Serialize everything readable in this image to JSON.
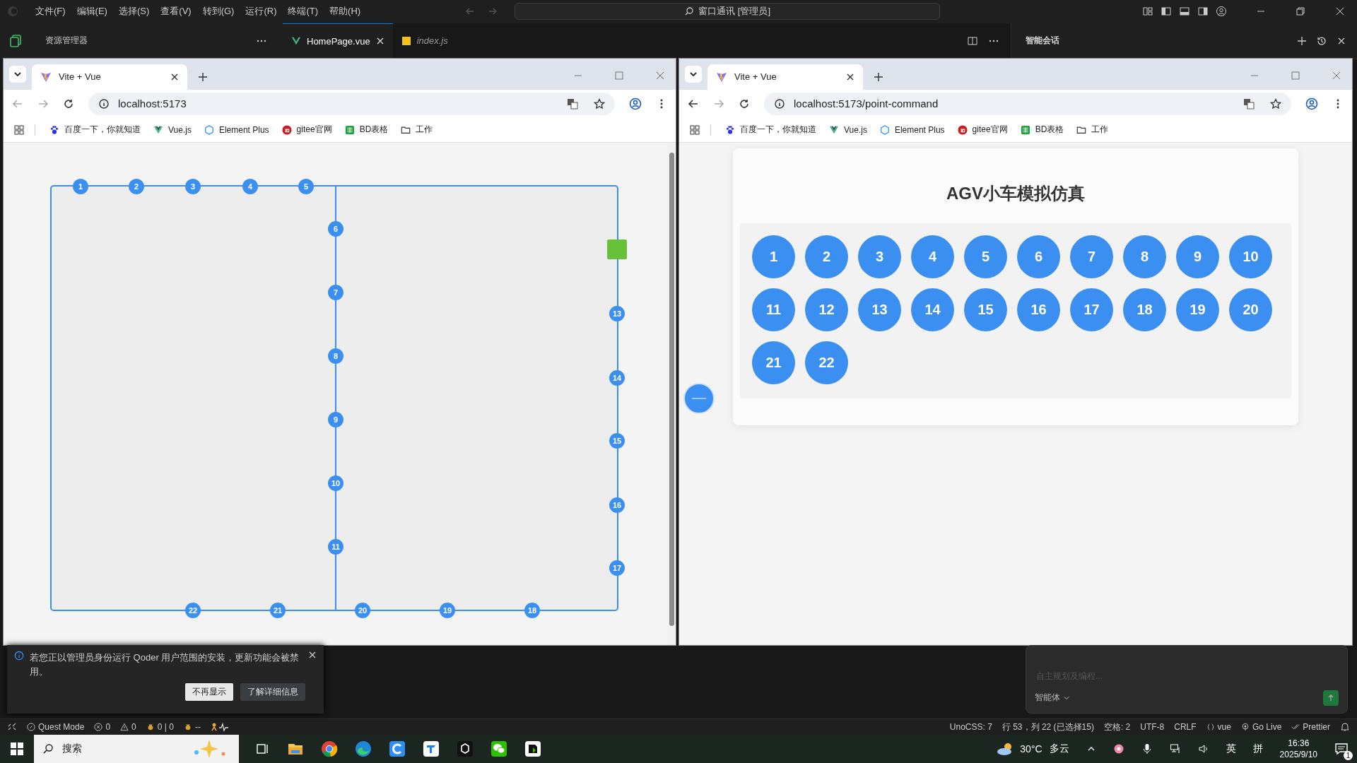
{
  "ide": {
    "menu": [
      "文件(F)",
      "编辑(E)",
      "选择(S)",
      "查看(V)",
      "转到(G)",
      "运行(R)",
      "终端(T)",
      "帮助(H)"
    ],
    "command_center": "窗口通讯 [管理员]",
    "explorer_title": "资源管理器",
    "editor_tabs": [
      {
        "label": "HomePage.vue",
        "kind": "vue",
        "selected": true
      },
      {
        "label": "index.js",
        "kind": "js",
        "selected": false
      }
    ],
    "chat_title": "智能会话",
    "chat_input": {
      "placeholder": "自主规划及编程..."
    },
    "chat_mode": "智能体"
  },
  "browsers": [
    {
      "tab_title": "Vite + Vue",
      "url": "localhost:5173",
      "can_go_back": false,
      "bookmarks": [
        {
          "kind": "paw",
          "label": "百度一下，你就知道"
        },
        {
          "kind": "vue",
          "label": "Vue.js"
        },
        {
          "kind": "element",
          "label": "Element Plus"
        },
        {
          "kind": "gitee",
          "label": "gitee官网"
        },
        {
          "kind": "sheet",
          "label": "BD表格"
        },
        {
          "kind": "folder",
          "label": "工作"
        }
      ],
      "page": {
        "kind": "map",
        "nodes": [
          {
            "label": "1"
          },
          {
            "label": "2"
          },
          {
            "label": "3"
          },
          {
            "label": "4"
          },
          {
            "label": "5"
          },
          {
            "label": "6"
          },
          {
            "label": "7"
          },
          {
            "label": "8"
          },
          {
            "label": "9"
          },
          {
            "label": "10"
          },
          {
            "label": "11"
          },
          {
            "label": "13"
          },
          {
            "label": "14"
          },
          {
            "label": "15"
          },
          {
            "label": "16"
          },
          {
            "label": "17"
          },
          {
            "label": "22"
          },
          {
            "label": "21"
          },
          {
            "label": "20"
          },
          {
            "label": "19"
          },
          {
            "label": "18"
          }
        ]
      }
    },
    {
      "tab_title": "Vite + Vue",
      "url": "localhost:5173/point-command",
      "can_go_back": true,
      "bookmarks": [
        {
          "kind": "paw",
          "label": "百度一下，你就知道"
        },
        {
          "kind": "vue",
          "label": "Vue.js"
        },
        {
          "kind": "element",
          "label": "Element Plus"
        },
        {
          "kind": "gitee",
          "label": "gitee官网"
        },
        {
          "kind": "sheet",
          "label": "BD表格"
        },
        {
          "kind": "folder",
          "label": "工作"
        }
      ],
      "page": {
        "kind": "simulator",
        "title": "AGV小车模拟仿真",
        "points": [
          "1",
          "2",
          "3",
          "4",
          "5",
          "6",
          "7",
          "8",
          "9",
          "10",
          "11",
          "12",
          "13",
          "14",
          "15",
          "16",
          "17",
          "18",
          "19",
          "20",
          "21",
          "22"
        ]
      }
    }
  ],
  "notification": {
    "message": "若您正以管理员身份运行 Qoder 用户范围的安装，更新功能会被禁用。",
    "buttons": [
      "不再显示",
      "了解详细信息"
    ]
  },
  "status_bar": {
    "left": [
      {
        "kind": "mode",
        "text": "Quest Mode"
      },
      {
        "kind": "errors",
        "text": "0"
      },
      {
        "kind": "warnings",
        "text": "0"
      },
      {
        "kind": "coin",
        "text": "0 | 0"
      },
      {
        "kind": "coin",
        "text": "--"
      }
    ],
    "right": [
      {
        "kind": "plain",
        "text": "UnoCSS: 7"
      },
      {
        "kind": "plain",
        "text": "行 53，列 22 (已选择15)"
      },
      {
        "kind": "plain",
        "text": "空格: 2"
      },
      {
        "kind": "plain",
        "text": "UTF-8"
      },
      {
        "kind": "plain",
        "text": "CRLF"
      },
      {
        "kind": "braces",
        "text": "vue"
      },
      {
        "kind": "golive",
        "text": "Go Live"
      },
      {
        "kind": "check",
        "text": "Prettier"
      }
    ]
  },
  "taskbar": {
    "search_placeholder": "搜索",
    "temperature": "30°C",
    "condition": "多云",
    "ime": [
      "英",
      "拼"
    ],
    "time": "16:36",
    "date": "2025/9/10",
    "notification_count": "1"
  }
}
